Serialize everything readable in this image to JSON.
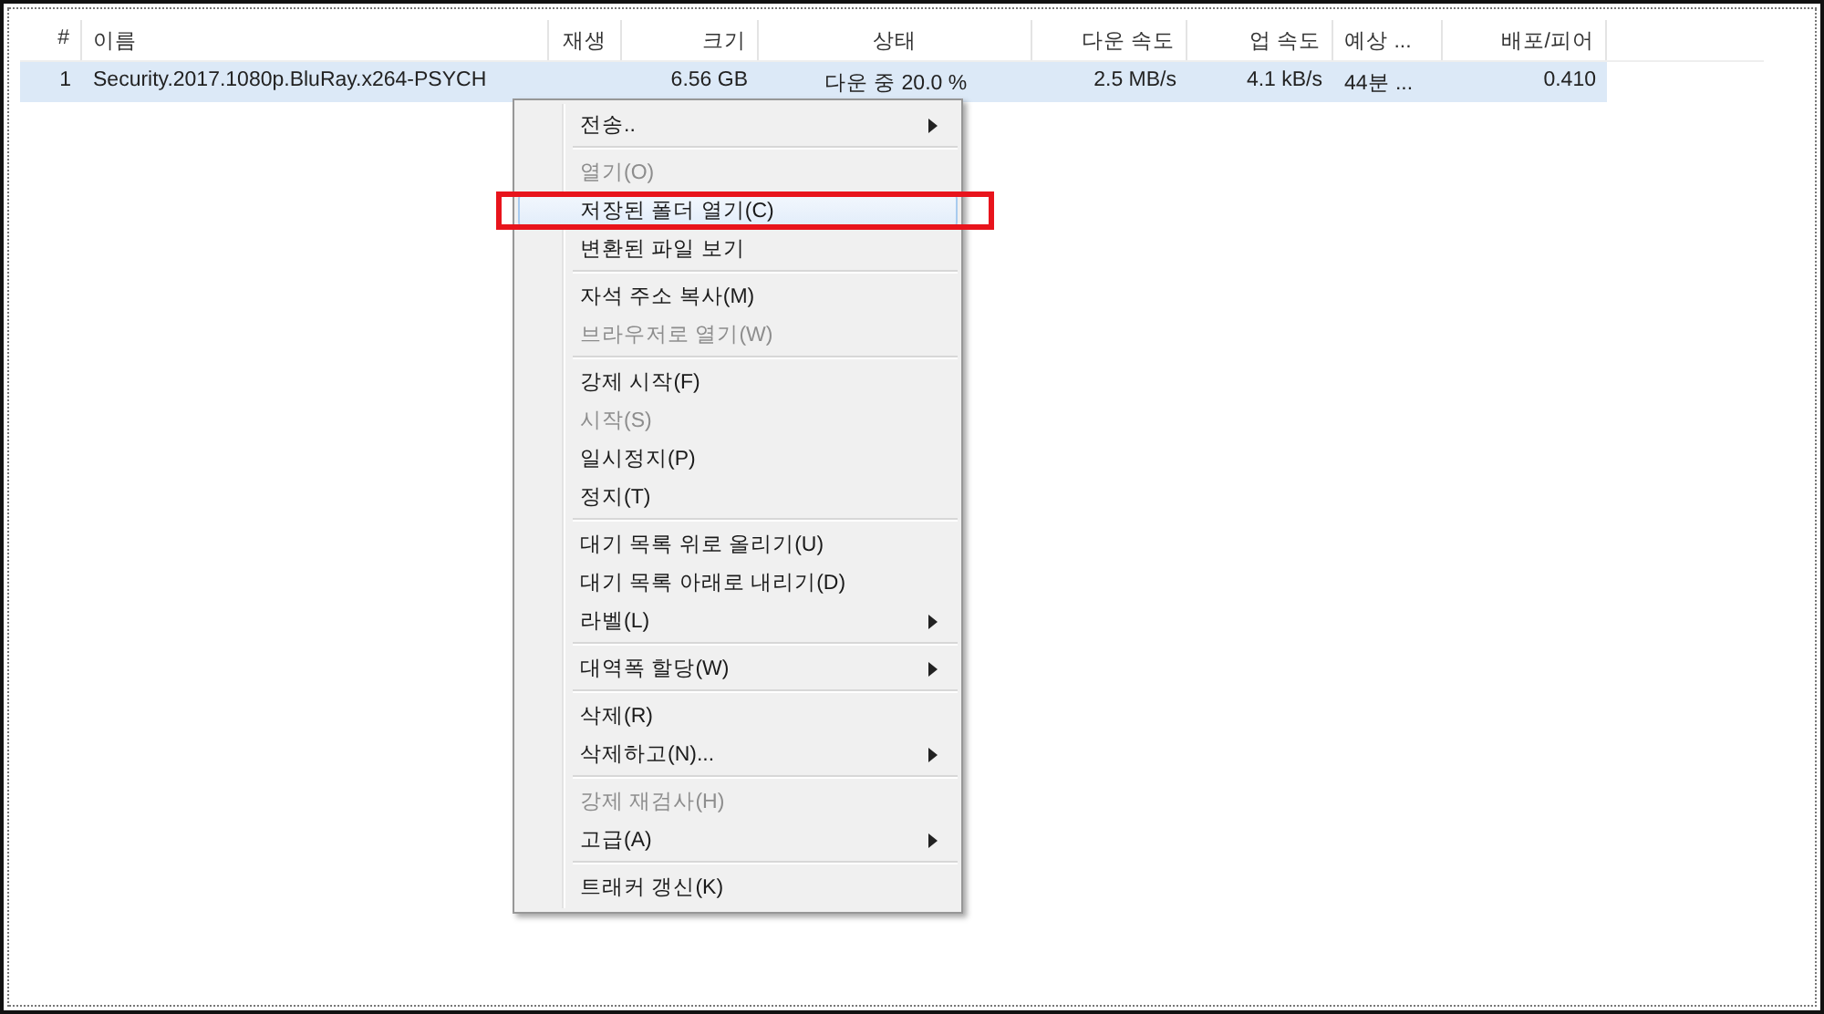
{
  "table": {
    "columns": [
      "#",
      "이름",
      "재생",
      "크기",
      "상태",
      "다운 속도",
      "업 속도",
      "예상 ...",
      "배포/피어"
    ],
    "rows": [
      {
        "selected": true,
        "cells": [
          "1",
          "Security.2017.1080p.BluRay.x264-PSYCH",
          "",
          "6.56 GB",
          "다운 중 20.0 %",
          "2.5 MB/s",
          "4.1 kB/s",
          "44분 ...",
          "0.410"
        ]
      }
    ]
  },
  "context_menu": {
    "groups": [
      [
        {
          "label": "전송..",
          "disabled": false,
          "selected": false,
          "submenu": true
        }
      ],
      [
        {
          "label": "열기(O)",
          "disabled": true,
          "selected": false,
          "submenu": false
        },
        {
          "label": "저장된 폴더 열기(C)",
          "disabled": false,
          "selected": true,
          "submenu": false
        },
        {
          "label": "변환된 파일 보기",
          "disabled": false,
          "selected": false,
          "submenu": false
        }
      ],
      [
        {
          "label": "자석 주소 복사(M)",
          "disabled": false,
          "selected": false,
          "submenu": false
        },
        {
          "label": "브라우저로 열기(W)",
          "disabled": true,
          "selected": false,
          "submenu": false
        }
      ],
      [
        {
          "label": "강제 시작(F)",
          "disabled": false,
          "selected": false,
          "submenu": false
        },
        {
          "label": "시작(S)",
          "disabled": true,
          "selected": false,
          "submenu": false
        },
        {
          "label": "일시정지(P)",
          "disabled": false,
          "selected": false,
          "submenu": false
        },
        {
          "label": "정지(T)",
          "disabled": false,
          "selected": false,
          "submenu": false
        }
      ],
      [
        {
          "label": "대기 목록 위로 올리기(U)",
          "disabled": false,
          "selected": false,
          "submenu": false
        },
        {
          "label": "대기 목록 아래로 내리기(D)",
          "disabled": false,
          "selected": false,
          "submenu": false
        },
        {
          "label": "라벨(L)",
          "disabled": false,
          "selected": false,
          "submenu": true
        }
      ],
      [
        {
          "label": "대역폭 할당(W)",
          "disabled": false,
          "selected": false,
          "submenu": true
        }
      ],
      [
        {
          "label": "삭제(R)",
          "disabled": false,
          "selected": false,
          "submenu": false
        },
        {
          "label": "삭제하고(N)...",
          "disabled": false,
          "selected": false,
          "submenu": true
        }
      ],
      [
        {
          "label": "강제 재검사(H)",
          "disabled": true,
          "selected": false,
          "submenu": false
        },
        {
          "label": "고급(A)",
          "disabled": false,
          "selected": false,
          "submenu": true
        }
      ],
      [
        {
          "label": "트래커 갱신(K)",
          "disabled": false,
          "selected": false,
          "submenu": false
        }
      ]
    ]
  }
}
